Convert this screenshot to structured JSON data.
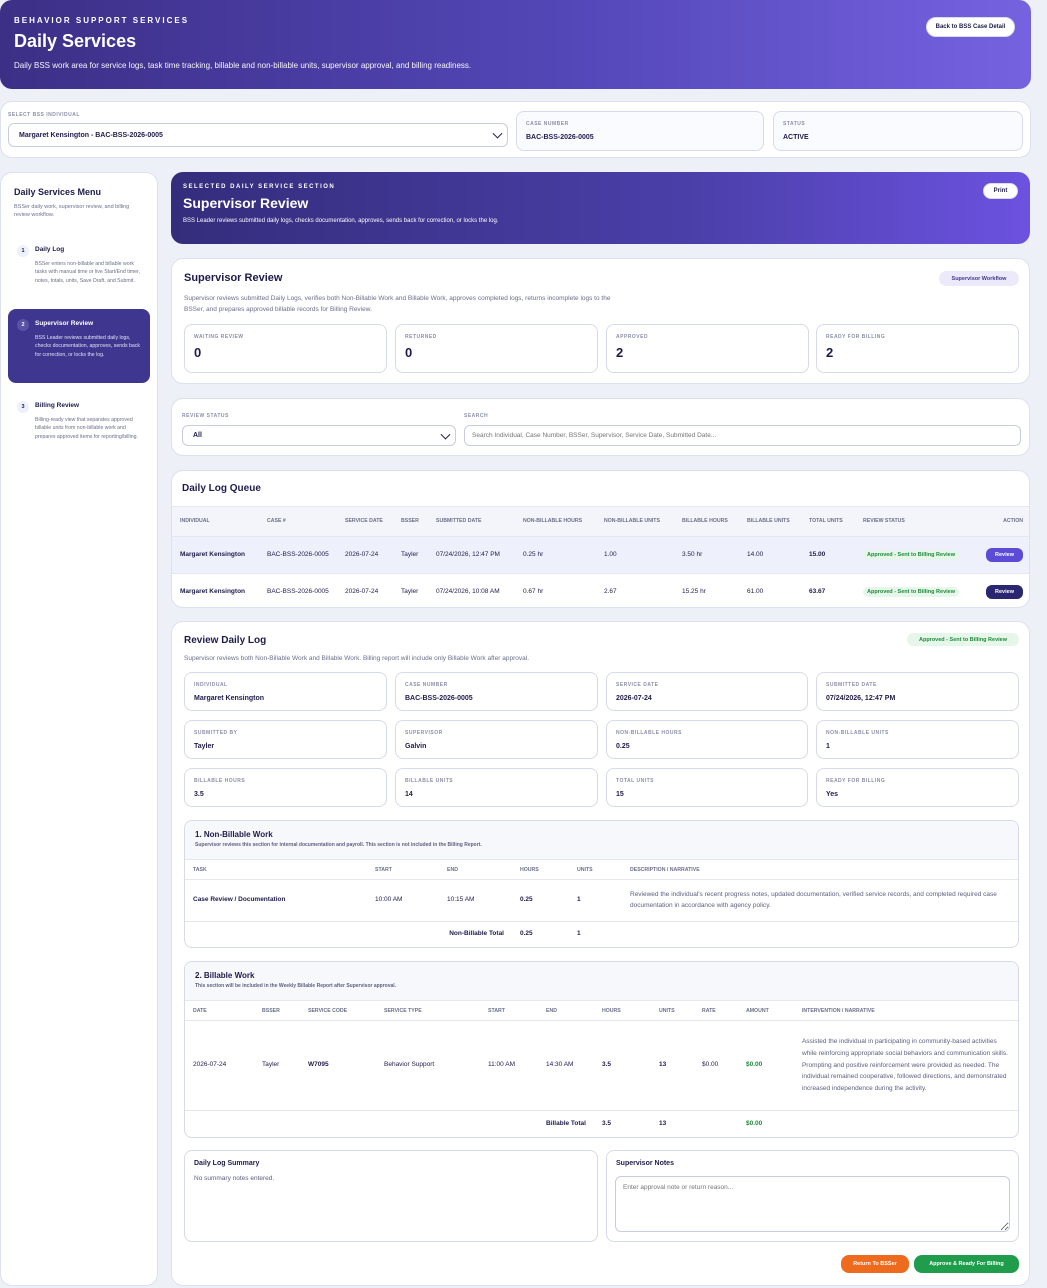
{
  "header": {
    "eyebrow": "BEHAVIOR SUPPORT SERVICES",
    "title": "Daily Services",
    "subtitle": "Daily BSS work area for service logs, task time tracking, billable and non-billable units, supervisor approval, and billing readiness.",
    "back_button": "Back to BSS Case Detail"
  },
  "selector": {
    "individual_label": "SELECT BSS INDIVIDUAL",
    "individual_value": "Margaret Kensington - BAC-BSS-2026-0005",
    "case_label": "CASE NUMBER",
    "case_value": "BAC-BSS-2026-0005",
    "status_label": "STATUS",
    "status_value": "ACTIVE"
  },
  "sidebar": {
    "title": "Daily Services Menu",
    "subtitle": "BSSer daily work, supervisor review, and billing review workflow.",
    "items": [
      {
        "num": "1",
        "title": "Daily Log",
        "desc": "BSSer enters non-billable and billable work tasks with manual time or live Start/End timer, notes, totals, units, Save Draft, and Submit."
      },
      {
        "num": "2",
        "title": "Supervisor Review",
        "desc": "BSS Leader reviews submitted daily logs, checks documentation, approves, sends back for correction, or locks the log."
      },
      {
        "num": "3",
        "title": "Billing Review",
        "desc": "Billing-ready view that separates approved billable units from non-billable work and prepares approved items for reporting/billing."
      }
    ]
  },
  "section": {
    "eyebrow": "SELECTED DAILY SERVICE SECTION",
    "title": "Supervisor Review",
    "desc": "BSS Leader reviews submitted daily logs, checks documentation, approves, sends back for correction, or locks the log.",
    "print": "Print"
  },
  "overview": {
    "title": "Supervisor Review",
    "badge": "Supervisor Workflow",
    "desc": "Supervisor reviews submitted Daily Logs, verifies both Non-Billable Work and Billable Work, approves completed logs, returns incomplete logs to the BSSer, and prepares approved billable records for Billing Review.",
    "stats": [
      {
        "label": "WAITING REVIEW",
        "value": "0"
      },
      {
        "label": "RETURNED",
        "value": "0"
      },
      {
        "label": "APPROVED",
        "value": "2"
      },
      {
        "label": "READY FOR BILLING",
        "value": "2"
      }
    ]
  },
  "filters": {
    "status_label": "REVIEW STATUS",
    "status_value": "All",
    "search_label": "SEARCH",
    "search_placeholder": "Search Individual, Case Number, BSSer, Supervisor, Service Date, Submitted Date..."
  },
  "queue": {
    "title": "Daily Log Queue",
    "columns": [
      "INDIVIDUAL",
      "CASE #",
      "SERVICE DATE",
      "BSSER",
      "SUBMITTED DATE",
      "NON-BILLABLE HOURS",
      "NON-BILLABLE UNITS",
      "BILLABLE HOURS",
      "BILLABLE UNITS",
      "TOTAL UNITS",
      "REVIEW STATUS",
      "ACTION"
    ],
    "rows": [
      {
        "individual": "Margaret Kensington",
        "case": "BAC-BSS-2026-0005",
        "service_date": "2026-07-24",
        "bsser": "Tayler",
        "submitted": "07/24/2026, 12:47 PM",
        "nb_hours": "0.25 hr",
        "nb_units": "1.00",
        "b_hours": "3.50 hr",
        "b_units": "14.00",
        "total": "15.00",
        "status": "Approved - Sent to Billing Review",
        "action": "Review"
      },
      {
        "individual": "Margaret Kensington",
        "case": "BAC-BSS-2026-0005",
        "service_date": "2026-07-24",
        "bsser": "Tayler",
        "submitted": "07/24/2026, 10:08 AM",
        "nb_hours": "0.67 hr",
        "nb_units": "2.67",
        "b_hours": "15.25 hr",
        "b_units": "61.00",
        "total": "63.67",
        "status": "Approved - Sent to Billing Review",
        "action": "Review"
      }
    ]
  },
  "review": {
    "title": "Review Daily Log",
    "badge": "Approved - Sent to Billing Review",
    "desc": "Supervisor reviews both Non-Billable Work and Billable Work. Billing report will include only Billable Work after approval.",
    "fields": [
      {
        "label": "INDIVIDUAL",
        "value": "Margaret Kensington"
      },
      {
        "label": "CASE NUMBER",
        "value": "BAC-BSS-2026-0005"
      },
      {
        "label": "SERVICE DATE",
        "value": "2026-07-24"
      },
      {
        "label": "SUBMITTED DATE",
        "value": "07/24/2026, 12:47 PM"
      },
      {
        "label": "SUBMITTED BY",
        "value": "Tayler"
      },
      {
        "label": "SUPERVISOR",
        "value": "Galvin"
      },
      {
        "label": "NON-BILLABLE HOURS",
        "value": "0.25"
      },
      {
        "label": "NON-BILLABLE UNITS",
        "value": "1"
      },
      {
        "label": "BILLABLE HOURS",
        "value": "3.5"
      },
      {
        "label": "BILLABLE UNITS",
        "value": "14"
      },
      {
        "label": "TOTAL UNITS",
        "value": "15"
      },
      {
        "label": "READY FOR BILLING",
        "value": "Yes"
      }
    ]
  },
  "nonbillable": {
    "title": "1. Non-Billable Work",
    "subtitle": "Supervisor reviews this section for internal documentation and payroll. This section is not included in the Billing Report.",
    "columns": [
      "TASK",
      "START",
      "END",
      "HOURS",
      "UNITS",
      "DESCRIPTION / NARRATIVE"
    ],
    "row": {
      "task": "Case Review / Documentation",
      "start": "10:00 AM",
      "end": "10:15 AM",
      "hours": "0.25",
      "units": "1",
      "desc": "Reviewed the individual's recent progress notes, updated documentation, verified service records, and completed required case documentation in accordance with agency policy."
    },
    "total_label": "Non-Billable Total",
    "total_hours": "0.25",
    "total_units": "1"
  },
  "billable": {
    "title": "2. Billable Work",
    "subtitle": "This section will be included in the Weekly Billable Report after Supervisor approval.",
    "columns": [
      "DATE",
      "BSSER",
      "SERVICE CODE",
      "SERVICE TYPE",
      "START",
      "END",
      "HOURS",
      "UNITS",
      "RATE",
      "AMOUNT",
      "INTERVENTION / NARRATIVE"
    ],
    "row": {
      "date": "2026-07-24",
      "bsser": "Tayler",
      "code": "W7095",
      "type": "Behavior Support",
      "start": "11:00 AM",
      "end": "14:30 AM",
      "hours": "3.5",
      "units": "13",
      "rate": "$0.00",
      "amount": "$0.00",
      "narrative": "Assisted the individual in participating in community-based activities while reinforcing appropriate social behaviors and communication skills. Prompting and positive reinforcement were provided as needed. The individual remained cooperative, followed directions, and demonstrated increased independence during the activity."
    },
    "total_label": "Billable Total",
    "total_hours": "3.5",
    "total_units": "13",
    "total_amount": "$0.00"
  },
  "summary": {
    "title": "Daily Log Summary",
    "text": "No summary notes entered.",
    "notes_title": "Supervisor Notes",
    "notes_placeholder": "Enter approval note or return reason..."
  },
  "actions": {
    "return": "Return To BSSer",
    "approve": "Approve & Ready For Billing"
  },
  "colors": {
    "accent": "#5b4bd6",
    "success": "#1f9d4c",
    "warning": "#ee6a1c",
    "navy": "#1e1b4b"
  }
}
